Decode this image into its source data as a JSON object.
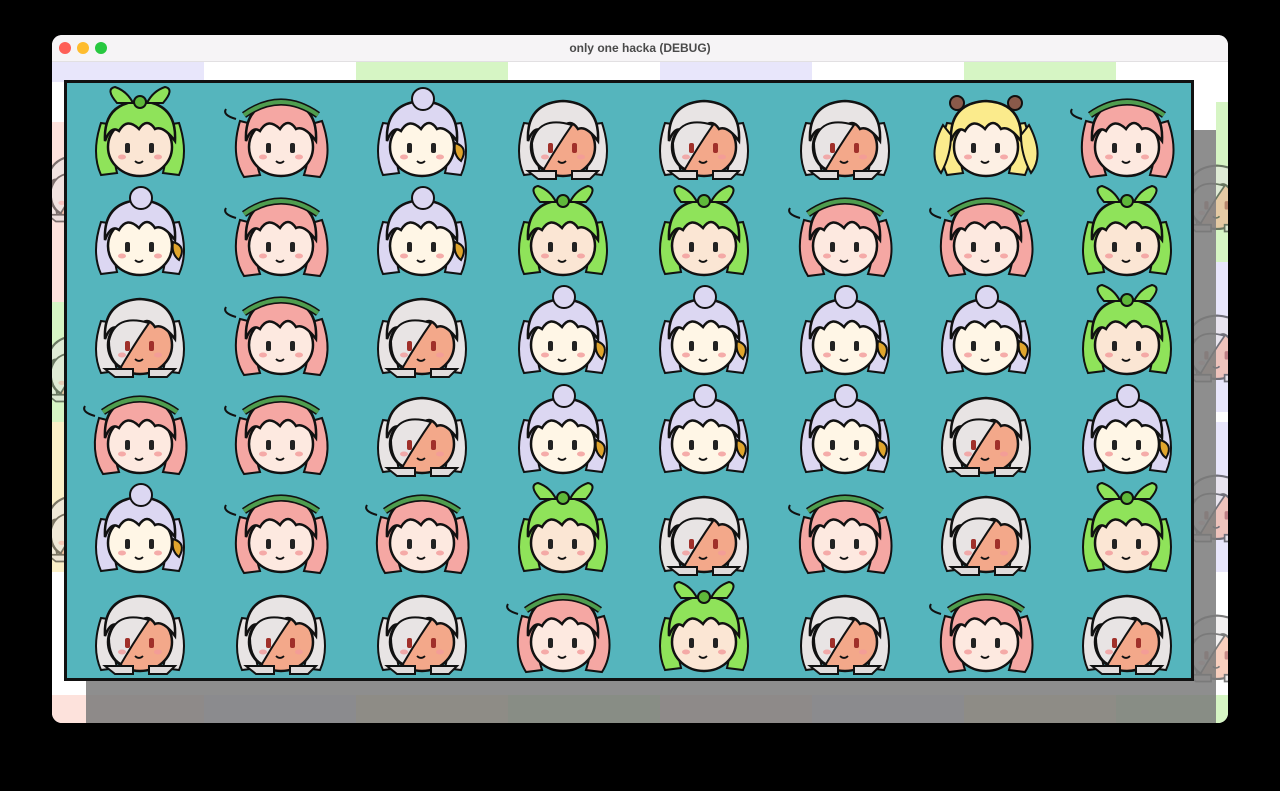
{
  "window": {
    "title": "only one hacka (DEBUG)"
  },
  "colors": {
    "board": "#55b5bd",
    "stripe_top": [
      "#e8e6fb",
      "#ffffff",
      "#d6f5c4",
      "#ffffff",
      "#e8e6fb",
      "#ffffff",
      "#d6f5c4",
      "#ffffff"
    ],
    "stripe_bottom": [
      "#fde2dc",
      "#e8e6fb",
      "#fbf0c8",
      "#d6f5c4",
      "#fde2dc",
      "#e8e6fb",
      "#fbf0c8",
      "#d6f5c4"
    ]
  },
  "characters": {
    "green": {
      "hair": "#8fe35a",
      "dark": "#5fb83a",
      "face": "#fbe6d4",
      "accent": "#8fe35a",
      "style": "bow"
    },
    "pink": {
      "hair": "#f5a7a3",
      "dark": "#e07f7c",
      "face": "#fde9e0",
      "accent": "#4f9e4f",
      "style": "band"
    },
    "purple": {
      "hair": "#dcd7f2",
      "dark": "#aaa3d6",
      "face": "#fff6e6",
      "accent": "#e0a52d",
      "style": "bun"
    },
    "white": {
      "hair": "#e8e4e4",
      "dark": "#bcb6b6",
      "face": "#f3a88a",
      "accent": "#e8e4e4",
      "style": "long"
    },
    "yellow": {
      "hair": "#fbeb8c",
      "dark": "#e0c75c",
      "face": "#fdf0e4",
      "accent": "#8a5a4a",
      "style": "twin"
    }
  },
  "grid": [
    [
      "green",
      "pink",
      "purple",
      "white",
      "white",
      "white",
      "yellow",
      "pink"
    ],
    [
      "purple",
      "pink",
      "purple",
      "green",
      "green",
      "pink",
      "pink",
      "green"
    ],
    [
      "white",
      "pink",
      "white",
      "purple",
      "purple",
      "purple",
      "purple",
      "green"
    ],
    [
      "pink",
      "pink",
      "white",
      "purple",
      "purple",
      "purple",
      "white",
      "purple"
    ],
    [
      "purple",
      "pink",
      "pink",
      "green",
      "white",
      "pink",
      "white",
      "green"
    ],
    [
      "white",
      "white",
      "white",
      "pink",
      "green",
      "white",
      "pink",
      "white"
    ]
  ]
}
